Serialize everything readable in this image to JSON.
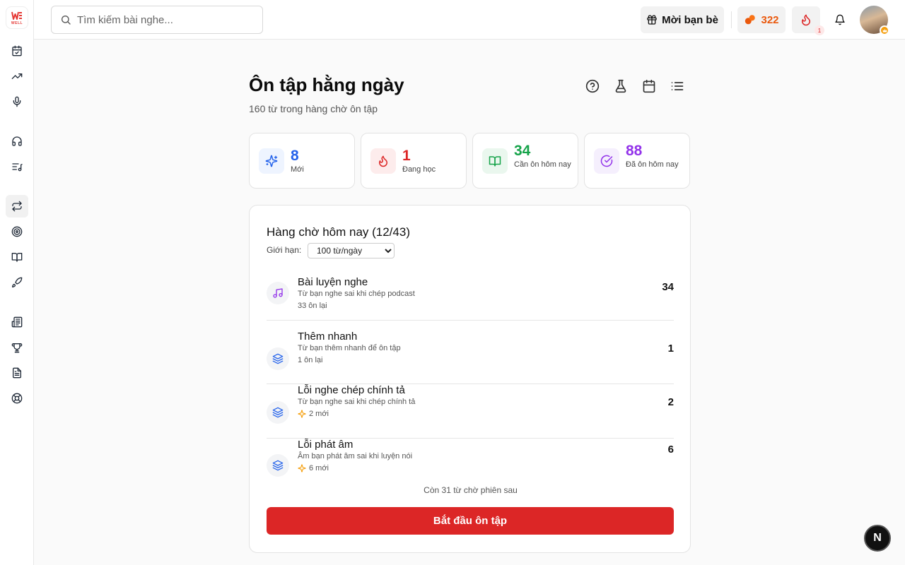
{
  "app": {
    "logo_text": "WELL"
  },
  "search": {
    "placeholder": "Tìm kiếm bài nghe..."
  },
  "header": {
    "invite_label": "Mời bạn bè",
    "points": "322",
    "streak_badge": "1"
  },
  "page": {
    "title": "Ôn tập hằng ngày",
    "subtitle": "160 từ trong hàng chờ ôn tập"
  },
  "stats": [
    {
      "value": "8",
      "label": "Mới",
      "color": "#2563eb"
    },
    {
      "value": "1",
      "label": "Đang học",
      "color": "#dc2626"
    },
    {
      "value": "34",
      "label": "Cần ôn hôm nay",
      "color": "#16a34a"
    },
    {
      "value": "88",
      "label": "Đã ôn hôm nay",
      "color": "#9333ea"
    }
  ],
  "queue": {
    "title": "Hàng chờ hôm nay (12/43)",
    "limit_label": "Giới hạn:",
    "limit_value": "100 từ/ngày",
    "items": [
      {
        "title": "Bài luyện nghe",
        "desc": "Từ bạn nghe sai khi chép podcast",
        "meta": "33 ôn lại",
        "count": "34",
        "icon": "music-icon"
      },
      {
        "title": "Thêm nhanh",
        "desc": "Từ bạn thêm nhanh để ôn tập",
        "meta": "1 ôn lại",
        "count": "1",
        "icon": "layers-icon"
      },
      {
        "title": "Lỗi nghe chép chính tả",
        "desc": "Từ bạn nghe sai khi chép chính tả",
        "meta": "2 mới",
        "count": "2",
        "icon": "layers-icon"
      },
      {
        "title": "Lỗi phát âm",
        "desc": "Âm bạn phát âm sai khi luyện nói",
        "meta": "6 mới",
        "count": "6",
        "icon": "layers-icon"
      }
    ],
    "remaining_text": "Còn 31 từ chờ phiên sau",
    "start_label": "Bắt đầu ôn tập"
  },
  "fab": {
    "label": "N"
  },
  "colors": {
    "accent": "#dc2626",
    "orange": "#ea580c"
  }
}
